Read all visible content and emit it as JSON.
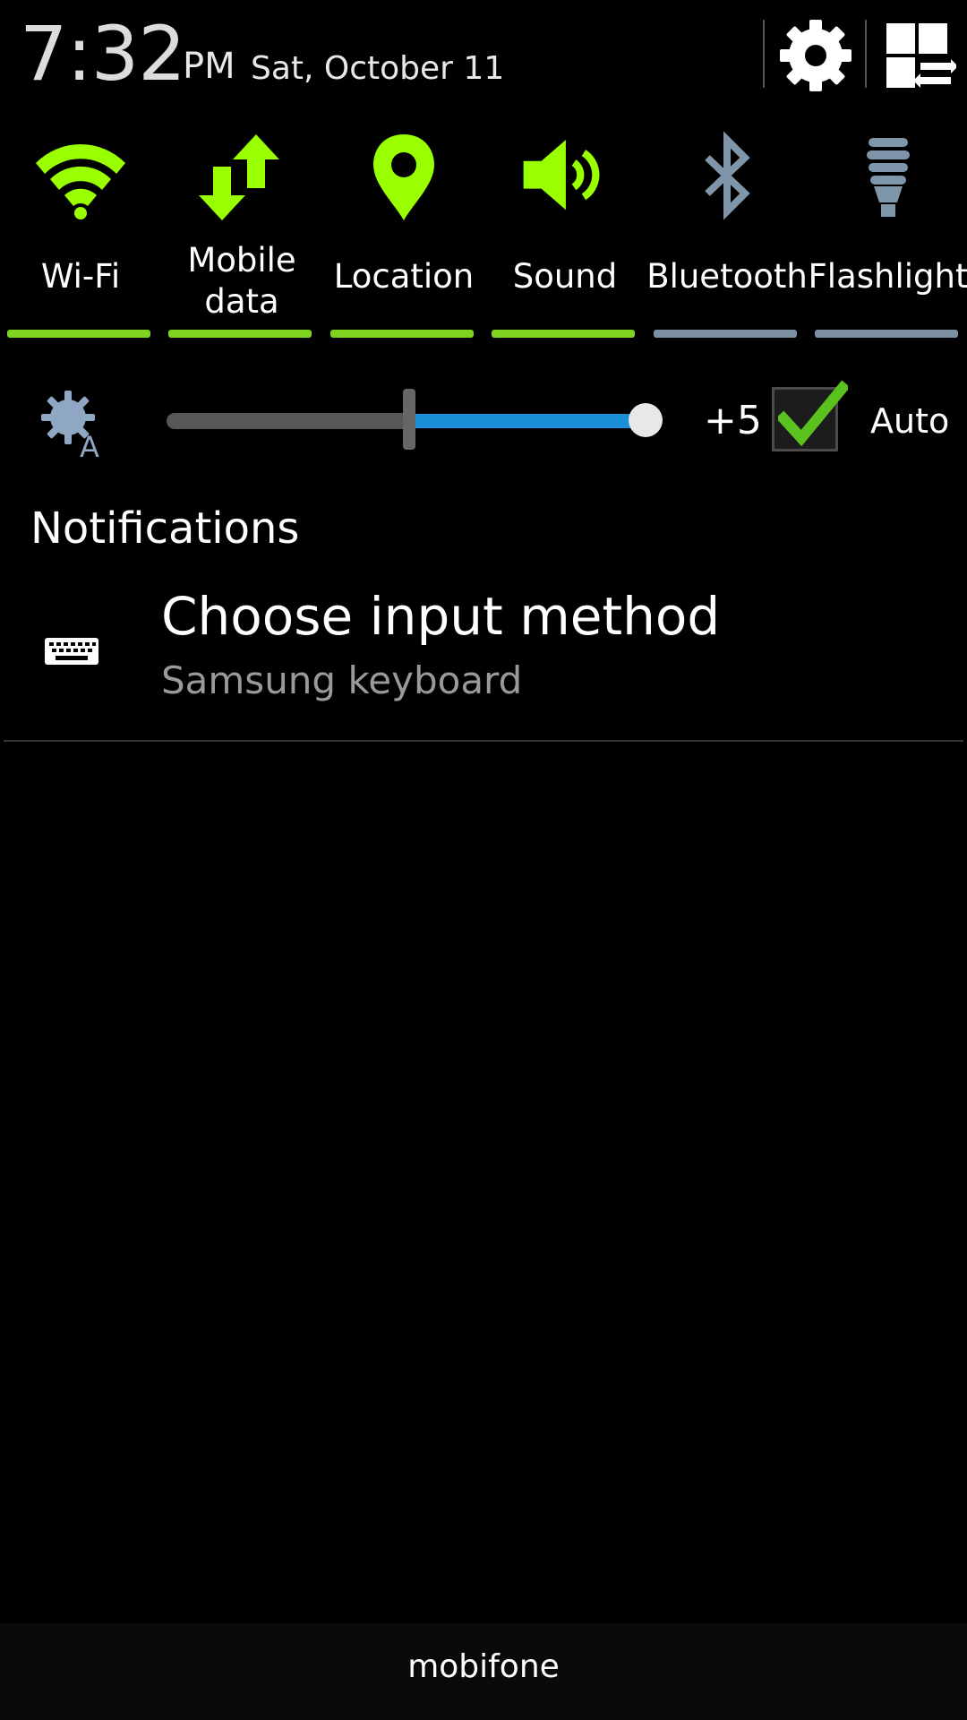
{
  "status": {
    "time": "7:32",
    "ampm": "PM",
    "date": "Sat, October 11"
  },
  "quick_settings": [
    {
      "label": "Wi-Fi",
      "icon": "wifi-icon",
      "on": true
    },
    {
      "label_line1": "Mobile",
      "label_line2": "data",
      "icon": "mobile-data-icon",
      "on": true
    },
    {
      "label": "Location",
      "icon": "location-pin-icon",
      "on": true
    },
    {
      "label": "Sound",
      "icon": "sound-icon",
      "on": true
    },
    {
      "label": "Bluetooth",
      "icon": "bluetooth-icon",
      "on": false
    },
    {
      "label": "Flashlight",
      "icon": "flashlight-icon",
      "on": false
    }
  ],
  "colors": {
    "active": "#9aff00",
    "active_bar": "#7ed321",
    "inactive": "#7f95aa",
    "inactive_bar": "#7d8fa3",
    "slider_fill": "#1b8fd8"
  },
  "brightness": {
    "value": "+5",
    "level_fraction": 1.0,
    "auto_label": "Auto",
    "auto_checked": true
  },
  "notifications": {
    "title": "Notifications",
    "items": [
      {
        "title": "Choose input method",
        "subtitle": "Samsung keyboard",
        "icon": "keyboard-icon"
      }
    ]
  },
  "carrier": "mobifone"
}
